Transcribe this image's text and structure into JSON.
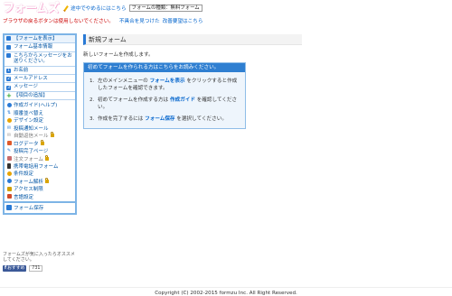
{
  "header": {
    "logo_text": "フォームズ",
    "quit_link": "途中でやめるにはこちら",
    "form_type": "フォームの種類：無料フォーム"
  },
  "notice": {
    "warning": "ブラウザの戻るボタンは使用しないでください。",
    "bug_link": "不具合を見つけた",
    "request_link": "改善要望はこちら"
  },
  "sidebar": {
    "show_form": "【フォームを表示】",
    "basic_info": "フォーム基本情報",
    "add_message": "こちらからメッセージをお送りください。",
    "rows": [
      {
        "num": "1",
        "label": "お名前"
      },
      {
        "num": "2",
        "label": "メールアドレス"
      },
      {
        "num": "3",
        "label": "メッセージ"
      }
    ],
    "add_item": "【項目の追加】",
    "tools": [
      {
        "label": "作成ガイド(ヘルプ)",
        "locked": false
      },
      {
        "label": "順番並べ替え",
        "locked": false
      },
      {
        "label": "デザイン設定",
        "locked": false
      },
      {
        "label": "投稿通知メール",
        "locked": false
      },
      {
        "label": "自動返信メール",
        "locked": true
      },
      {
        "label": "ログデータ",
        "locked": false
      },
      {
        "label": "投稿完了ページ",
        "locked": false
      },
      {
        "label": "注文フォーム",
        "locked": true
      },
      {
        "label": "携帯電話用フォーム",
        "locked": false
      },
      {
        "label": "条件設定",
        "locked": false
      },
      {
        "label": "フォーム解析",
        "locked": false
      },
      {
        "label": "アクセス制限",
        "locked": false
      },
      {
        "label": "言語設定",
        "locked": false
      }
    ],
    "save": "フォーム保存"
  },
  "share": {
    "text": "フォームズが気に入ったらオススメしてください。",
    "fb_label": "おすすめ",
    "count": "731"
  },
  "main": {
    "title": "新規フォーム",
    "intro": "新しいフォームを作成します。",
    "box_title": "初めてフォームを作られる方はこちらをお読みください。",
    "steps": [
      {
        "num": "1.",
        "pre": "左のメインメニューの ",
        "link": "フォームを表示",
        "post": " をクリックすると作成したフォームを確認できます。"
      },
      {
        "num": "2.",
        "pre": "初めてフォームを作成する方は ",
        "link": "作成ガイド",
        "post": " を確認してください。"
      },
      {
        "num": "3.",
        "pre": "作成を完了するには ",
        "link": "フォーム保存",
        "post": " を選択してください。"
      }
    ]
  },
  "footer": {
    "copyright": "Copyright (C) 2002-2015 formzu Inc. All Right Reserved."
  },
  "colors": {
    "accent": "#2f7fd1",
    "logo": "#e4007f",
    "warning": "#cc0000",
    "link": "#0063cc"
  }
}
